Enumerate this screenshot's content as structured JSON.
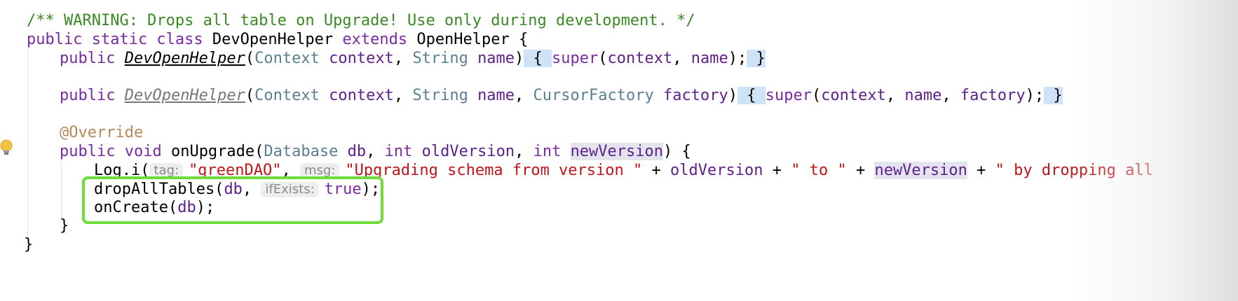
{
  "comment": "/** WARNING: Drops all table on Upgrade! Use only during development. */",
  "line2": {
    "kw": "public static class",
    "name": " DevOpenHelper ",
    "extends": "extends",
    "parent": " OpenHelper {"
  },
  "line3": {
    "kw": "public ",
    "ctor": "DevOpenHelper",
    "open": "(",
    "t1": "Context ",
    "p1": "context",
    "comma": ", ",
    "t2": "String ",
    "p2": "name",
    "close": ")",
    "fold_open": " { ",
    "super": "super",
    "args_open": "(",
    "a1": "context",
    "a_comma": ", ",
    "a2": "name",
    "args_close": ");",
    "fold_close": " }"
  },
  "line4": {
    "kw": "public ",
    "ctor": "DevOpenHelper",
    "open": "(",
    "t1": "Context ",
    "p1": "context",
    "c1": ", ",
    "t2": "String ",
    "p2": "name",
    "c2": ", ",
    "t3": "CursorFactory ",
    "p3": "factory",
    "close": ")",
    "fold_open": " { ",
    "super": "super",
    "args_open": "(",
    "a1": "context",
    "a_c1": ", ",
    "a2": "name",
    "a_c2": ", ",
    "a3": "factory",
    "args_close": ");",
    "fold_close": " }"
  },
  "line5": {
    "anno": "@Override"
  },
  "line6": {
    "kw": "public void ",
    "method": "onUpgrade",
    "open": "(",
    "t1": "Database ",
    "p1": "db",
    "c1": ", ",
    "t2": "int ",
    "p2": "oldVersion",
    "c2": ", ",
    "t3": "int ",
    "p3": "newVersion",
    "close": ") {"
  },
  "line7": {
    "call": "Log.i(",
    "hint1": "tag:",
    "s1": "\"greenDAO\"",
    "c1": ", ",
    "hint2": "msg:",
    "s2": "\"Upgrading schema from version \"",
    "plus1": " + ",
    "v1": "oldVersion",
    "plus2": " + ",
    "s3": "\" to \"",
    "plus3": " + ",
    "v2": "newVersion",
    "plus4": " + ",
    "s4": "\" by dropping all"
  },
  "line8": {
    "call": "dropAllTables(",
    "arg": "db",
    "comma": ", ",
    "hint": "ifExists:",
    "val": "true",
    "end": ");"
  },
  "line9": {
    "call": "onCreate(",
    "arg": "db",
    "end": ");"
  },
  "line10": {
    "brace": "}"
  },
  "line11": {
    "brace": "}"
  },
  "icons": {
    "bulb": "lightbulb-icon"
  },
  "colors": {
    "callout_border": "#6fdc3c",
    "comment": "#3a8a24",
    "keyword": "#7a2aa0",
    "string": "#c0161a"
  }
}
